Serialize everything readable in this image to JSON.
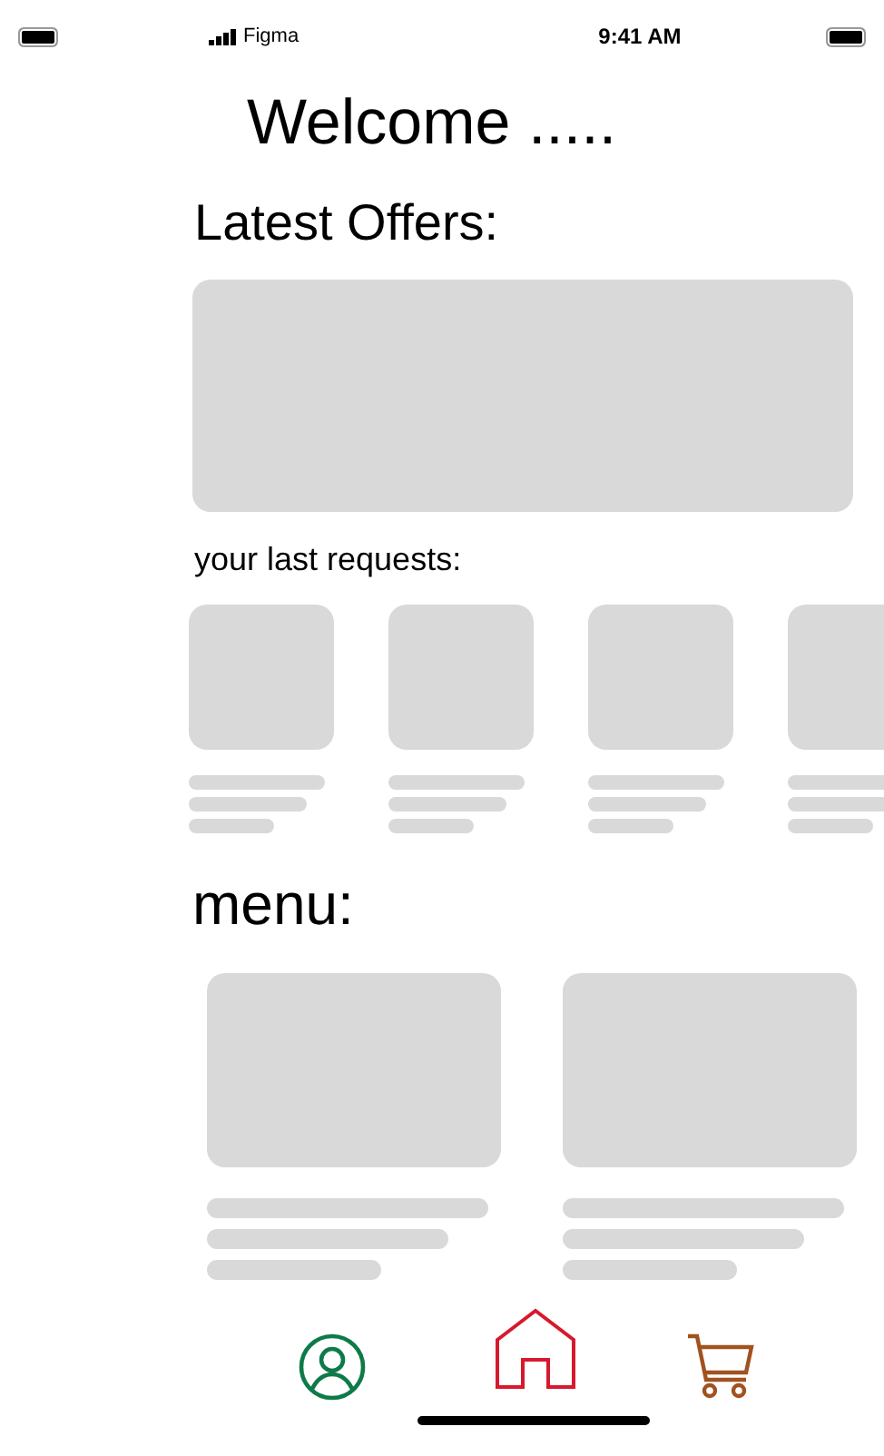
{
  "status_bar": {
    "carrier": "Figma",
    "time": "9:41 AM"
  },
  "title": "Welcome .....",
  "offers": {
    "heading": "Latest Offers:",
    "banner": {
      "kind": "placeholder"
    }
  },
  "requests": {
    "heading": "your last requests:",
    "items": [
      {
        "kind": "placeholder"
      },
      {
        "kind": "placeholder"
      },
      {
        "kind": "placeholder"
      },
      {
        "kind": "placeholder"
      }
    ]
  },
  "menu": {
    "heading": "menu:",
    "items": [
      {
        "kind": "placeholder"
      },
      {
        "kind": "placeholder"
      }
    ]
  },
  "nav": [
    {
      "kind": "profile",
      "color": "#0e7a4a"
    },
    {
      "kind": "home",
      "color": "#d7192d"
    },
    {
      "kind": "cart",
      "color": "#a0521f"
    }
  ]
}
